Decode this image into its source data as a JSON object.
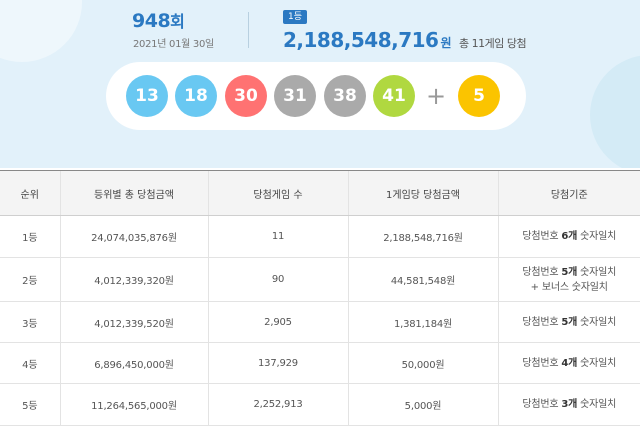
{
  "draw": {
    "round_number": "948",
    "round_suffix": "회",
    "date": "2021년 01월 30일",
    "first_rank_badge": "1등",
    "first_prize_amount": "2,188,548,716",
    "first_prize_unit": "원",
    "first_prize_winners": "총 11게임 당첨",
    "numbers": [
      "13",
      "18",
      "30",
      "31",
      "38",
      "41"
    ],
    "plus_symbol": "+",
    "bonus": "5"
  },
  "colors": {
    "ball_blue": "#69c8f2",
    "ball_red": "#ff7272",
    "ball_gray": "#aaaaaa",
    "ball_green": "#b0d840",
    "ball_yellow": "#fbc400",
    "accent": "#2b79c2"
  },
  "table": {
    "headers": [
      "순위",
      "등위별 총 당첨금액",
      "당첨게임 수",
      "1게임당 당첨금액",
      "당첨기준"
    ],
    "rows": [
      {
        "rank": "1등",
        "total": "24,074,035,876원",
        "winners": "11",
        "per_game": "2,188,548,716원",
        "crit_pre": "당첨번호 ",
        "crit_hi": "6개",
        "crit_post": " 숫자일치",
        "crit_line2": ""
      },
      {
        "rank": "2등",
        "total": "4,012,339,320원",
        "winners": "90",
        "per_game": "44,581,548원",
        "crit_pre": "당첨번호 ",
        "crit_hi": "5개",
        "crit_post": " 숫자일치",
        "crit_line2": "+ 보너스 숫자일치"
      },
      {
        "rank": "3등",
        "total": "4,012,339,520원",
        "winners": "2,905",
        "per_game": "1,381,184원",
        "crit_pre": "당첨번호 ",
        "crit_hi": "5개",
        "crit_post": " 숫자일치",
        "crit_line2": ""
      },
      {
        "rank": "4등",
        "total": "6,896,450,000원",
        "winners": "137,929",
        "per_game": "50,000원",
        "crit_pre": "당첨번호 ",
        "crit_hi": "4개",
        "crit_post": " 숫자일치",
        "crit_line2": ""
      },
      {
        "rank": "5등",
        "total": "11,264,565,000원",
        "winners": "2,252,913",
        "per_game": "5,000원",
        "crit_pre": "당첨번호 ",
        "crit_hi": "3개",
        "crit_post": " 숫자일치",
        "crit_line2": ""
      }
    ]
  }
}
